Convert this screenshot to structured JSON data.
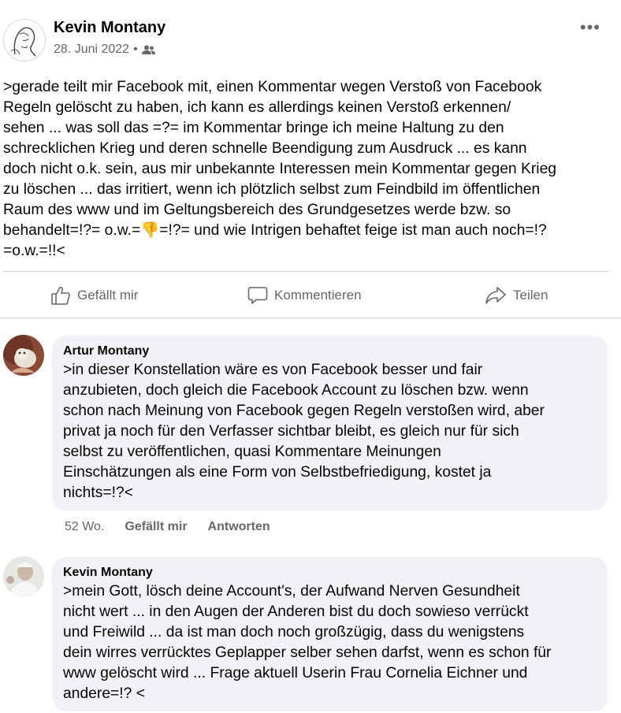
{
  "post": {
    "author": "Kevin Montany",
    "date": "28. Juni 2022",
    "separator": "•",
    "audience_icon": "friends-icon",
    "more_label": "•••",
    "text": ">gerade teilt mir Facebook mit, einen Kommentar wegen Verstoß von Facebook\nRegeln gelöscht zu haben, ich kann es allerdings keinen Verstoß erkennen/\nsehen ... was soll das =?= im Kommentar bringe ich meine Haltung zu den\nschrecklichen Krieg und deren schnelle Beendigung zum Ausdruck ... es kann\ndoch nicht o.k. sein, aus mir unbekannte Interessen mein Kommentar gegen Krieg\nzu löschen ... das irritiert, wenn ich plötzlich selbst zum Feindbild im öffentlichen\nRaum des www und im Geltungsbereich des Grundgesetzes werde bzw. so\nbehandelt=!?= o.w.=👎=!?= und wie Intrigen behaftet feige ist man auch noch=!?\n=o.w.=!!<"
  },
  "actions": {
    "like": "Gefällt mir",
    "comment": "Kommentieren",
    "share": "Teilen"
  },
  "comments": [
    {
      "author": "Artur Montany",
      "text": ">in dieser Konstellation wäre es von Facebook besser und fair\nanzubieten, doch gleich die Facebook Account zu löschen bzw. wenn\nschon nach Meinung von Facebook gegen Regeln verstoßen wird, aber\nprivat ja noch für den Verfasser sichtbar bleibt, es gleich nur für sich\nselbst zu veröffentlichen, quasi Kommentare Meinungen\nEinschätzungen als eine Form von Selbstbefriedigung, kostet ja\nnichts=!?<",
      "age": "52 Wo.",
      "like": "Gefällt mir",
      "reply": "Antworten"
    },
    {
      "author": "Kevin Montany",
      "text": ">mein Gott, lösch deine Account's, der Aufwand Nerven Gesundheit\nnicht wert ... in den Augen der Anderen bist du doch sowieso verrückt\nund Freiwild ... da ist man doch noch großzügig, dass du wenigstens\ndein wirres verrücktes Geplapper selber sehen darfst, wenn es schon für\nwww gelöscht wird ... Frage aktuell Userin Frau Cornelia Eichner und\nandere=!? <"
    }
  ],
  "colors": {
    "text": "#050505",
    "secondary": "#65676b",
    "bubble": "#f0f2f5",
    "divider": "#ced0d4"
  }
}
